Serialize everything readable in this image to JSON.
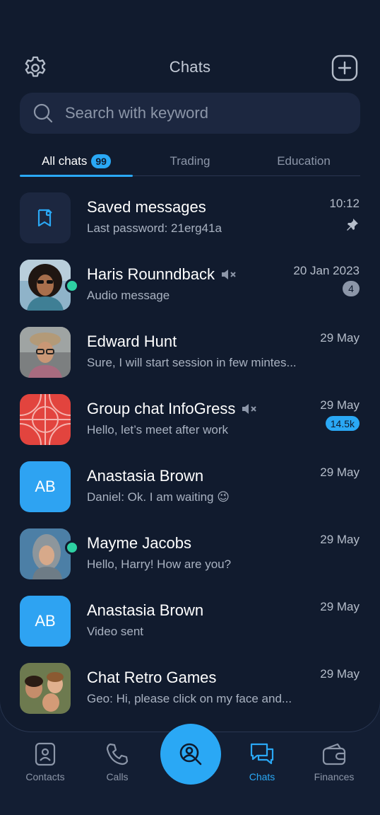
{
  "header": {
    "title": "Chats"
  },
  "search": {
    "placeholder": "Search with keyword",
    "value": ""
  },
  "tabs": [
    {
      "label": "All chats",
      "count": "99",
      "active": true
    },
    {
      "label": "Trading",
      "active": false
    },
    {
      "label": "Education",
      "active": false
    }
  ],
  "chats": [
    {
      "name": "Saved messages",
      "message": "Last password: 21erg41a",
      "time": "10:12",
      "pinned": true,
      "avatar": "bookmark-icon"
    },
    {
      "name": "Haris Rounndback",
      "message": "Audio message",
      "time": "20 Jan 2023",
      "unread": "4",
      "muted": true,
      "online": true,
      "avatar": "photo"
    },
    {
      "name": "Edward Hunt",
      "message": "Sure, I will start session in few mintes...",
      "time": "29 May",
      "avatar": "photo"
    },
    {
      "name": "Group chat InfoGress",
      "message": "Hello, let’s meet after work",
      "time": "29 May",
      "unread": "14.5k",
      "muted": true,
      "avatar": "pattern"
    },
    {
      "name": "Anastasia Brown",
      "initials": "AB",
      "message": "Daniel: Ok. I am waiting",
      "emoji": "😉",
      "time": "29 May"
    },
    {
      "name": "Mayme Jacobs",
      "message": "Hello, Harry! How are you?",
      "time": "29 May",
      "online": true,
      "avatar": "photo"
    },
    {
      "name": "Anastasia Brown",
      "initials": "AB",
      "message": "Video sent",
      "time": "29 May"
    },
    {
      "name": "Chat Retro Games",
      "message": "Geo: Hi, please click on my face and...",
      "time": "29 May",
      "avatar": "photo"
    }
  ],
  "bottom_nav": [
    {
      "label": "Contacts",
      "icon": "contacts-icon"
    },
    {
      "label": "Calls",
      "icon": "phone-icon"
    },
    {
      "label": "Chats",
      "icon": "chats-icon",
      "active": true
    },
    {
      "label": "Finances",
      "icon": "wallet-icon"
    }
  ],
  "colors": {
    "accent": "#2aa8f5",
    "background": "#111b2e",
    "online": "#2ed1a3"
  }
}
